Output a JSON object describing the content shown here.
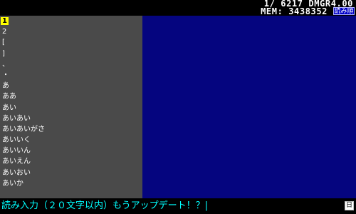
{
  "status": {
    "position": "1/ 6217 DMGR4.00",
    "memory": "MEM: 3438352",
    "mode_badge": "読み順"
  },
  "word_list": {
    "items": [
      {
        "label": "1",
        "selected": true
      },
      {
        "label": "2",
        "selected": false
      },
      {
        "label": "[",
        "selected": false
      },
      {
        "label": "]",
        "selected": false
      },
      {
        "label": "、",
        "selected": false
      },
      {
        "label": "・",
        "selected": false
      },
      {
        "label": "あ",
        "selected": false
      },
      {
        "label": "ああ",
        "selected": false
      },
      {
        "label": "あい",
        "selected": false
      },
      {
        "label": "あいあい",
        "selected": false
      },
      {
        "label": "あいあいがさ",
        "selected": false
      },
      {
        "label": "あいいく",
        "selected": false
      },
      {
        "label": "あいいん",
        "selected": false
      },
      {
        "label": "あいえん",
        "selected": false
      },
      {
        "label": "あいおい",
        "selected": false
      },
      {
        "label": "あいか",
        "selected": false
      }
    ]
  },
  "input": {
    "prompt": "読み入力（２０文字以内）もうアップデート！？|",
    "icon_label": "日"
  },
  "colors": {
    "list_background": "#4a4a4a",
    "detail_background": "#05057f",
    "selection": "#ffff00",
    "prompt_text": "#00ffff"
  }
}
